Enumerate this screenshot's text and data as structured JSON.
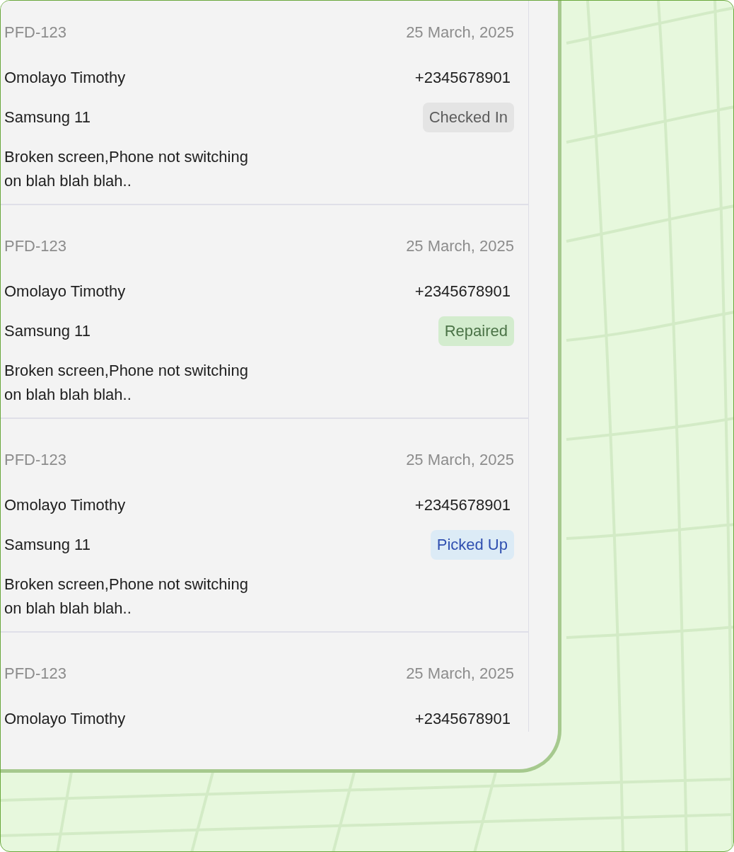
{
  "orders": [
    {
      "order_id": "PFD-123",
      "date": "25 March, 2025",
      "customer": "Omolayo Timothy",
      "phone": "+2345678901",
      "device": "Samsung 11",
      "status": {
        "label": "Checked In",
        "kind": "checked_in"
      },
      "issue": "Broken screen,Phone not switching on blah blah blah.."
    },
    {
      "order_id": "PFD-123",
      "date": "25 March, 2025",
      "customer": "Omolayo Timothy",
      "phone": "+2345678901",
      "device": "Samsung 11",
      "status": {
        "label": "Repaired",
        "kind": "repaired"
      },
      "issue": "Broken screen,Phone not switching on blah blah blah.."
    },
    {
      "order_id": "PFD-123",
      "date": "25 March, 2025",
      "customer": "Omolayo Timothy",
      "phone": "+2345678901",
      "device": "Samsung 11",
      "status": {
        "label": "Picked Up",
        "kind": "picked_up"
      },
      "issue": "Broken screen,Phone not switching on blah blah blah.."
    },
    {
      "order_id": "PFD-123",
      "date": "25 March, 2025",
      "customer": "Omolayo Timothy",
      "phone": "+2345678901"
    }
  ]
}
